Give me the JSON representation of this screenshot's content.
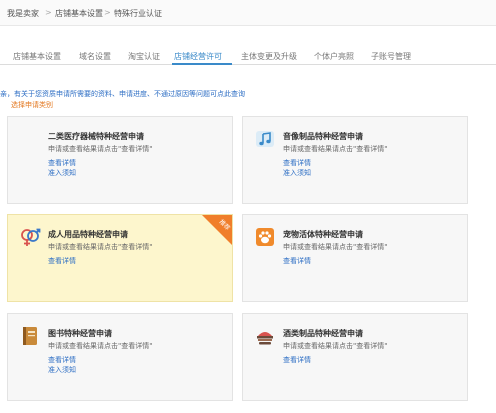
{
  "breadcrumb": {
    "items": [
      "我是卖家",
      "店铺基本设置",
      "特殊行业认证"
    ],
    "separator": ">"
  },
  "tabs": [
    {
      "label": "店铺基本设置",
      "active": false
    },
    {
      "label": "域名设置",
      "active": false
    },
    {
      "label": "淘宝认证",
      "active": false
    },
    {
      "label": "店铺经营许可",
      "active": true
    },
    {
      "label": "主体变更及升级",
      "active": false
    },
    {
      "label": "个体户亮照",
      "active": false
    },
    {
      "label": "子账号管理",
      "active": false
    }
  ],
  "notice": "亲，有关于您资质申请所需要的资料、申请进度、不通过原因等问题可点此查询",
  "choose_label": "选择申请类别",
  "cards": [
    {
      "title": "二类医疗器械特种经营申请",
      "desc": "申请或查看结果请点击\"查看详情\"",
      "link1": "查看详情",
      "link2": "准入须知",
      "icon": "medical-device-icon"
    },
    {
      "title": "音像制品特种经营申请",
      "desc": "申请或查看结果请点击\"查看详情\"",
      "link1": "查看详情",
      "link2": "准入须知",
      "icon": "music-note-icon"
    },
    {
      "title": "成人用品特种经营申请",
      "desc": "申请或查看结果请点击\"查看详情\"",
      "link1": "查看详情",
      "badge": "推荐",
      "icon": "gender-symbol-icon"
    },
    {
      "title": "宠物活体特种经营申请",
      "desc": "申请或查看结果请点击\"查看详情\"",
      "link1": "查看详情",
      "icon": "paw-icon"
    },
    {
      "title": "图书特种经营申请",
      "desc": "申请或查看结果请点击\"查看详情\"",
      "link1": "查看详情",
      "link2": "准入须知",
      "icon": "book-icon"
    },
    {
      "title": "酒类制品特种经营申请",
      "desc": "申请或查看结果请点击\"查看详情\"",
      "link1": "查看详情",
      "icon": "food-bowl-icon"
    }
  ],
  "colors": {
    "accent": "#3a8ac9",
    "link": "#2d6ec4",
    "orange": "#e3771f",
    "badge": "#f07e2a",
    "highlight_card": "#fdf6cd"
  }
}
